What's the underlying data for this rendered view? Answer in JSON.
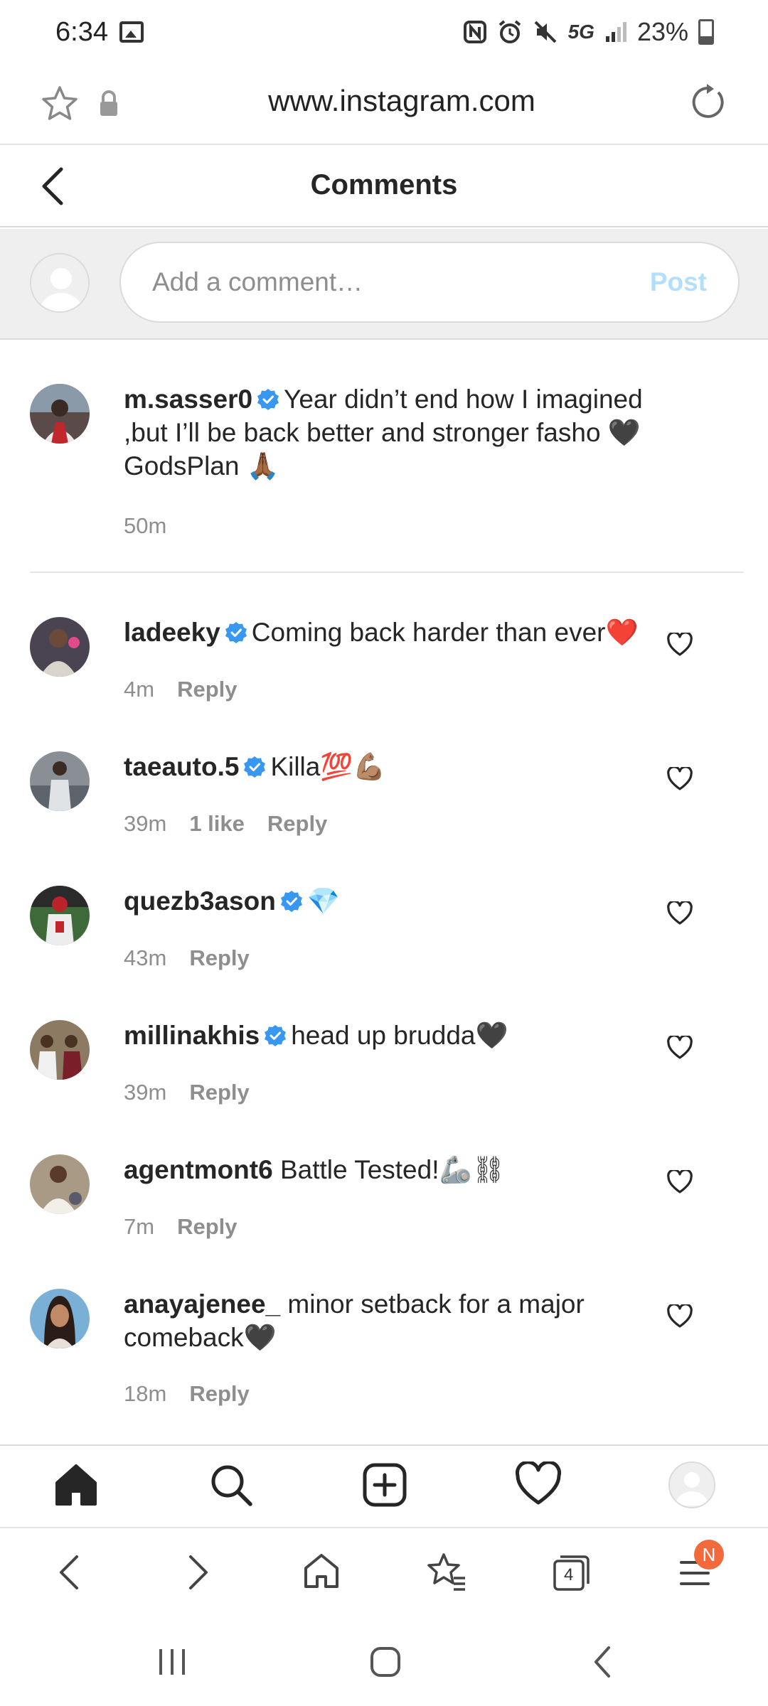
{
  "status_bar": {
    "time": "6:34",
    "network": "5G",
    "battery": "23%"
  },
  "browser": {
    "url": "www.instagram.com"
  },
  "header": {
    "title": "Comments"
  },
  "composer": {
    "placeholder": "Add a comment…",
    "post_label": "Post"
  },
  "caption": {
    "username": "m.sasser0",
    "verified": true,
    "text": "Year didn’t end how I imagined ,but I’ll be back better and stronger fasho 🖤 GodsPlan 🙏🏾",
    "time": "50m"
  },
  "comments": [
    {
      "username": "ladeeky",
      "verified": true,
      "text": "Coming back harder than ever❤️",
      "time": "4m",
      "likes": "",
      "reply": "Reply"
    },
    {
      "username": "taeauto.5",
      "verified": true,
      "text": "Killa💯💪🏽",
      "time": "39m",
      "likes": "1 like",
      "reply": "Reply"
    },
    {
      "username": "quezb3ason",
      "verified": true,
      "text": "💎",
      "time": "43m",
      "likes": "",
      "reply": "Reply"
    },
    {
      "username": "millinakhis",
      "verified": true,
      "text": "head up brudda🖤",
      "time": "39m",
      "likes": "",
      "reply": "Reply"
    },
    {
      "username": "agentmont6",
      "verified": false,
      "text": "Battle Tested!🦾⛓",
      "time": "7m",
      "likes": "",
      "reply": "Reply"
    },
    {
      "username": "anayajenee_",
      "verified": false,
      "text": "minor setback for a major comeback🖤",
      "time": "18m",
      "likes": "",
      "reply": "Reply"
    }
  ],
  "browser_toolbar": {
    "tabs_count": "4",
    "menu_badge": "N"
  },
  "icons": {
    "status": [
      "image-icon",
      "nfc-icon",
      "alarm-icon",
      "mute-icon",
      "signal-icon",
      "battery-icon"
    ],
    "url_bar": [
      "star-icon",
      "lock-icon",
      "reload-icon"
    ],
    "ig_nav": [
      "home-icon",
      "search-icon",
      "new-post-icon",
      "activity-heart-icon",
      "profile-avatar-icon"
    ],
    "browser_toolbar": [
      "back-icon",
      "forward-icon",
      "home-outline-icon",
      "bookmarks-icon",
      "tabs-icon",
      "menu-icon"
    ],
    "system_nav": [
      "recents-icon",
      "home-circle-icon",
      "back-chevron-icon"
    ]
  },
  "colors": {
    "verified_blue": "#3897f0",
    "post_disabled": "#b2dffc",
    "meta_gray": "#8e8e8e",
    "badge_orange": "#f26a3b"
  }
}
